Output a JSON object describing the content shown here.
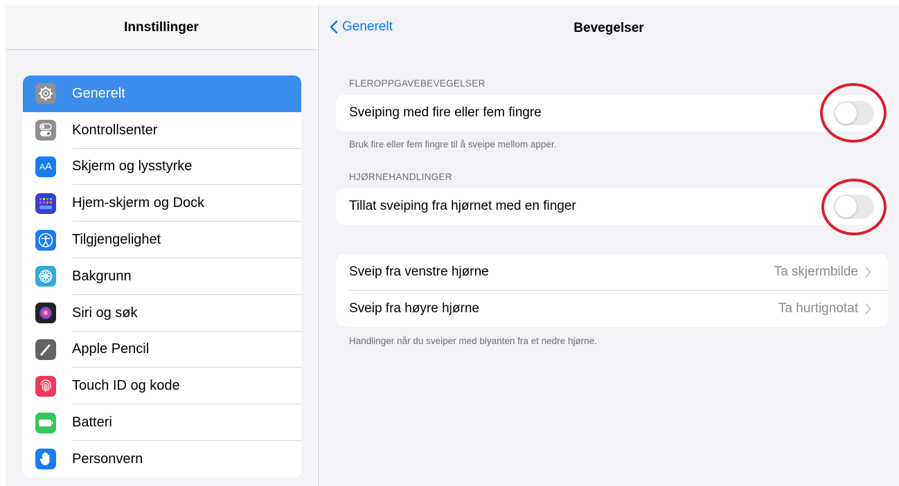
{
  "sidebar": {
    "title": "Innstillinger",
    "items": [
      {
        "label": "Generelt",
        "icon": "gear-icon",
        "color": "#8e8e93",
        "selected": true
      },
      {
        "label": "Kontrollsenter",
        "icon": "toggles-icon",
        "color": "#8e8e93"
      },
      {
        "label": "Skjerm og lysstyrke",
        "icon": "text-size-icon",
        "color": "#1a7cf5"
      },
      {
        "label": "Hjem-skjerm og Dock",
        "icon": "home-grid-icon",
        "color": "#3b3fd1"
      },
      {
        "label": "Tilgjengelighet",
        "icon": "accessibility-icon",
        "color": "#1a7cf5"
      },
      {
        "label": "Bakgrunn",
        "icon": "flower-icon",
        "color": "#34aadc"
      },
      {
        "label": "Siri og søk",
        "icon": "siri-icon",
        "color": "#222"
      },
      {
        "label": "Apple Pencil",
        "icon": "pencil-icon",
        "color": "#636366"
      },
      {
        "label": "Touch ID og kode",
        "icon": "fingerprint-icon",
        "color": "#f0385a"
      },
      {
        "label": "Batteri",
        "icon": "battery-icon",
        "color": "#34c759"
      },
      {
        "label": "Personvern",
        "icon": "hand-icon",
        "color": "#1a7cf5"
      }
    ]
  },
  "main": {
    "back_label": "Generelt",
    "title": "Bevegelser",
    "section1": {
      "header": "FLEROPPGAVEBEVEGELSER",
      "row_label": "Sveiping med fire eller fem fingre",
      "toggle_on": false,
      "footer": "Bruk fire eller fem fingre til å sveipe mellom apper."
    },
    "section2": {
      "header": "HJØRNEHANDLINGER",
      "row_label": "Tillat sveiping fra hjørnet med en finger",
      "toggle_on": false
    },
    "section3": {
      "rows": [
        {
          "label": "Sveip fra venstre hjørne",
          "value": "Ta skjermbilde"
        },
        {
          "label": "Sveip fra høyre hjørne",
          "value": "Ta hurtignotat"
        }
      ],
      "footer": "Handlinger når du sveiper med blyanten fra et nedre hjørne."
    }
  },
  "colors": {
    "accent": "#0a7aff",
    "selected_bg": "#3c8ceb",
    "annotation_red": "#dd1e2c"
  }
}
